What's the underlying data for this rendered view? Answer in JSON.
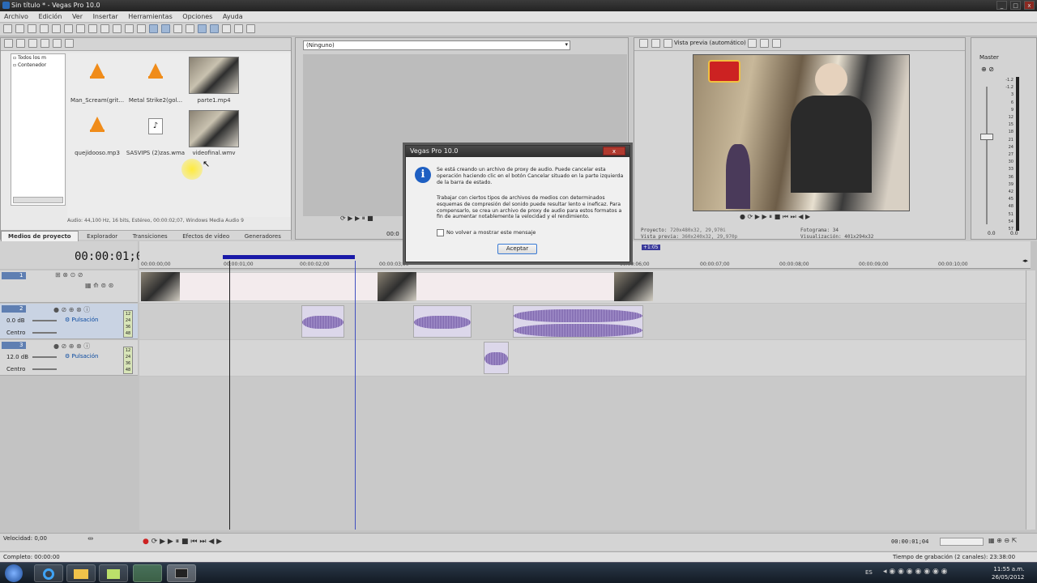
{
  "window": {
    "title": "Sin título * - Vegas Pro 10.0"
  },
  "menu": [
    "Archivo",
    "Edición",
    "Ver",
    "Insertar",
    "Herramientas",
    "Opciones",
    "Ayuda"
  ],
  "explorer": {
    "tree": [
      "Todos los m",
      "Contenedor"
    ]
  },
  "media": [
    {
      "name": "Man_Scream(grit...",
      "kind": "audio"
    },
    {
      "name": "Metal Strike2(gol...",
      "kind": "audio"
    },
    {
      "name": "parte1.mp4",
      "kind": "video"
    },
    {
      "name": "quejidooso.mp3",
      "kind": "audio"
    },
    {
      "name": "SASVIPS (2)zas.wma",
      "kind": "wma"
    },
    {
      "name": "videofinal.wmv",
      "kind": "video"
    }
  ],
  "media_status": "Audio: 44,100 Hz, 16 bits, Estéreo, 00:00:02;07, Windows Media Audio 9",
  "tabs": [
    "Medios de proyecto",
    "Explorador",
    "Transiciones",
    "Efectos de vídeo",
    "Generadores"
  ],
  "trimmer": {
    "dropdown": "(Ninguno)",
    "time": "00:0"
  },
  "preview": {
    "mode": "Vista previa (automático)",
    "proyecto_label": "Proyecto:",
    "proyecto_value": "720x480x32, 29,970i",
    "vista_label": "Vista previa:",
    "vista_value": "360x240x32, 29,970p",
    "fotograma_label": "Fotograma:",
    "fotograma_value": "34",
    "visualizacion_label": "Visualización:",
    "visualizacion_value": "401x294x32"
  },
  "master": {
    "label": "Master",
    "scale": [
      "-1.2",
      "-1.2",
      "3",
      "6",
      "9",
      "12",
      "15",
      "18",
      "21",
      "24",
      "27",
      "30",
      "33",
      "36",
      "39",
      "42",
      "45",
      "48",
      "51",
      "54",
      "57"
    ],
    "bottom": [
      "0.0",
      "0.0"
    ]
  },
  "timeline": {
    "timecode": "00:00:01;04",
    "ruler": [
      "00:00:00;00",
      "00:00:01;00",
      "00:00:02;00",
      "00:00:03;00",
      "00:00:06;00",
      "00:00:07;00",
      "00:00:08;00",
      "00:00:09;00",
      "00:00:10;00"
    ],
    "loop_marker": "+1:05"
  },
  "tracks": [
    {
      "num": "1",
      "type": "video"
    },
    {
      "num": "2",
      "type": "audio",
      "vol": "0.0 dB",
      "mode": "Pulsación",
      "pan": "Centro",
      "meter": [
        "12",
        "24",
        "36",
        "48"
      ]
    },
    {
      "num": "3",
      "type": "audio",
      "vol": "12.0 dB",
      "mode": "Pulsación",
      "pan": "Centro",
      "meter": [
        "12",
        "24",
        "36",
        "48"
      ]
    }
  ],
  "transport": {
    "velocidad": "Velocidad: 0,00",
    "time": "00:00:01;04"
  },
  "status": {
    "left": "Completo: 00:00:00",
    "right": "Tiempo de grabación (2 canales): 23:38:00"
  },
  "dialog": {
    "title": "Vegas Pro 10.0",
    "para1": "Se está creando un archivo de proxy de audio. Puede cancelar esta operación haciendo clic en el botón Cancelar situado en la parte izquierda de la barra de estado.",
    "para2": "Trabajar con ciertos tipos de archivos de medios con determinados esquemas de compresión del sonido puede resultar lento e ineficaz. Para compensarlo, se crea un archivo de proxy de audio para estos formatos a fin de aumentar notablemente la velocidad y el rendimiento.",
    "checkbox": "No volver a mostrar este mensaje",
    "ok": "Aceptar"
  },
  "taskbar": {
    "lang": "ES",
    "time": "11:55 a.m.",
    "date": "26/05/2012"
  },
  "colors": {
    "accent": "#2a5db0",
    "dialog_info": "#1e5fc2",
    "loop_bar": "#1a1aa8"
  }
}
